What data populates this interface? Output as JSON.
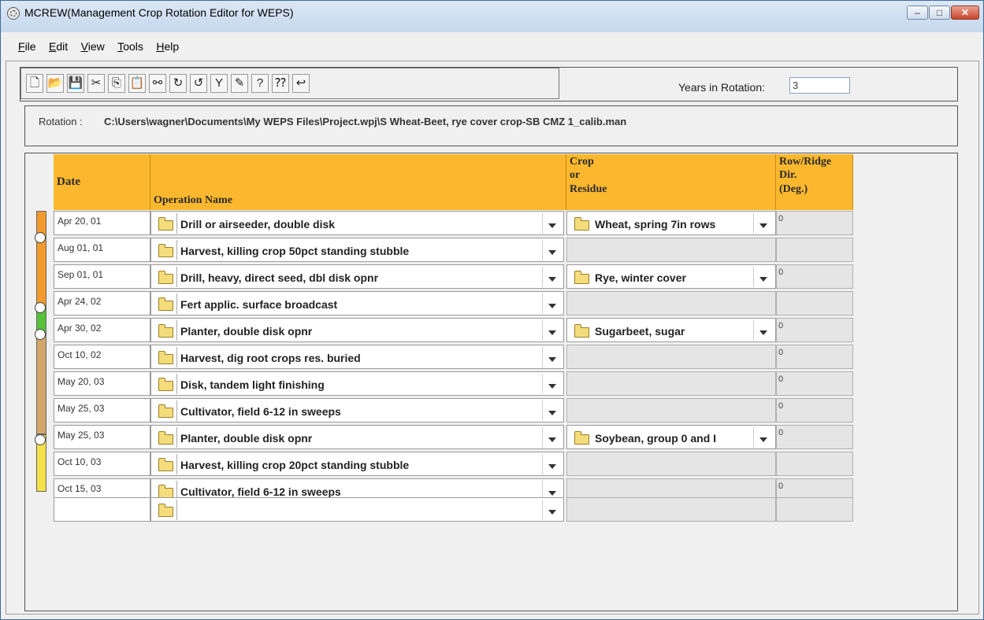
{
  "window": {
    "title": "MCREW(Management Crop Rotation Editor for WEPS)",
    "minimize_glyph": "–",
    "maximize_glyph": "□",
    "close_glyph": "✕"
  },
  "menu": [
    "File",
    "Edit",
    "View",
    "Tools",
    "Help"
  ],
  "toolbar": {
    "buttons": [
      {
        "icon": "new-file-icon",
        "glyph": "🗋"
      },
      {
        "icon": "open-folder-icon",
        "glyph": "📂"
      },
      {
        "icon": "save-disk-icon",
        "glyph": "💾"
      },
      {
        "icon": "cut-scissors-icon",
        "glyph": "✂"
      },
      {
        "icon": "copy-icon",
        "glyph": "⎘"
      },
      {
        "icon": "paste-icon",
        "glyph": "📋"
      },
      {
        "icon": "link-chain-icon",
        "glyph": "⚯"
      },
      {
        "icon": "rotate-right-icon",
        "glyph": "↻"
      },
      {
        "icon": "rotate-left-icon",
        "glyph": "↺"
      },
      {
        "icon": "filter-funnel-icon",
        "glyph": "Y"
      },
      {
        "icon": "pencil-edit-icon",
        "glyph": "✎"
      },
      {
        "icon": "help-bulb-icon",
        "glyph": "?"
      },
      {
        "icon": "context-help-icon",
        "glyph": "⁇"
      },
      {
        "icon": "return-arrow-icon",
        "glyph": "↩"
      }
    ],
    "years_label": "Years in Rotation:",
    "years_value": "3"
  },
  "rotation": {
    "label": "Rotation :",
    "path": "C:\\Users\\wagner\\Documents\\My WEPS Files\\Project.wpj\\S Wheat-Beet, rye cover crop-SB CMZ 1_calib.man"
  },
  "table": {
    "headers": {
      "date": "Date",
      "operation": "Operation Name",
      "crop_line1": "Crop",
      "crop_line2": "or",
      "crop_line3": "Residue",
      "row_line1": "Row/Ridge",
      "row_line2": "Dir.",
      "row_line3": "(Deg.)"
    },
    "rows": [
      {
        "date": "Apr 20, 01",
        "operation": "Drill or airseeder, double disk",
        "crop": "Wheat, spring 7in rows",
        "dir": "0"
      },
      {
        "date": "Aug 01, 01",
        "operation": "Harvest, killing crop 50pct standing stubble",
        "crop": "",
        "dir": ""
      },
      {
        "date": "Sep 01, 01",
        "operation": "Drill, heavy, direct seed, dbl disk opnr",
        "crop": "Rye, winter cover",
        "dir": "0"
      },
      {
        "date": "Apr 24, 02",
        "operation": "Fert applic. surface broadcast",
        "crop": "",
        "dir": ""
      },
      {
        "date": "Apr 30, 02",
        "operation": "Planter, double disk opnr",
        "crop": "Sugarbeet, sugar",
        "dir": "0"
      },
      {
        "date": "Oct 10, 02",
        "operation": "Harvest, dig root crops res. buried",
        "crop": "",
        "dir": "0"
      },
      {
        "date": "May 20, 03",
        "operation": "Disk, tandem light finishing",
        "crop": "",
        "dir": "0"
      },
      {
        "date": "May 25, 03",
        "operation": "Cultivator, field 6-12 in sweeps",
        "crop": "",
        "dir": "0"
      },
      {
        "date": "May 25, 03",
        "operation": "Planter, double disk opnr",
        "crop": "Soybean, group 0 and I",
        "dir": "0"
      },
      {
        "date": "Oct 10, 03",
        "operation": "Harvest, killing crop 20pct standing stubble",
        "crop": "",
        "dir": ""
      },
      {
        "date": "Oct 15, 03",
        "operation": "Cultivator, field 6-12 in sweeps",
        "crop": "",
        "dir": "0"
      },
      {
        "date": "",
        "operation": "",
        "crop": "",
        "dir": ""
      }
    ]
  },
  "colors": {
    "header_bg": "#fbb82e",
    "timeline_wheat": "#f39a2c",
    "timeline_rye": "#f39a2c",
    "timeline_sugarbeet": "#57c23a",
    "timeline_fallow": "#d2a56a",
    "timeline_soybean": "#f5e14a"
  }
}
